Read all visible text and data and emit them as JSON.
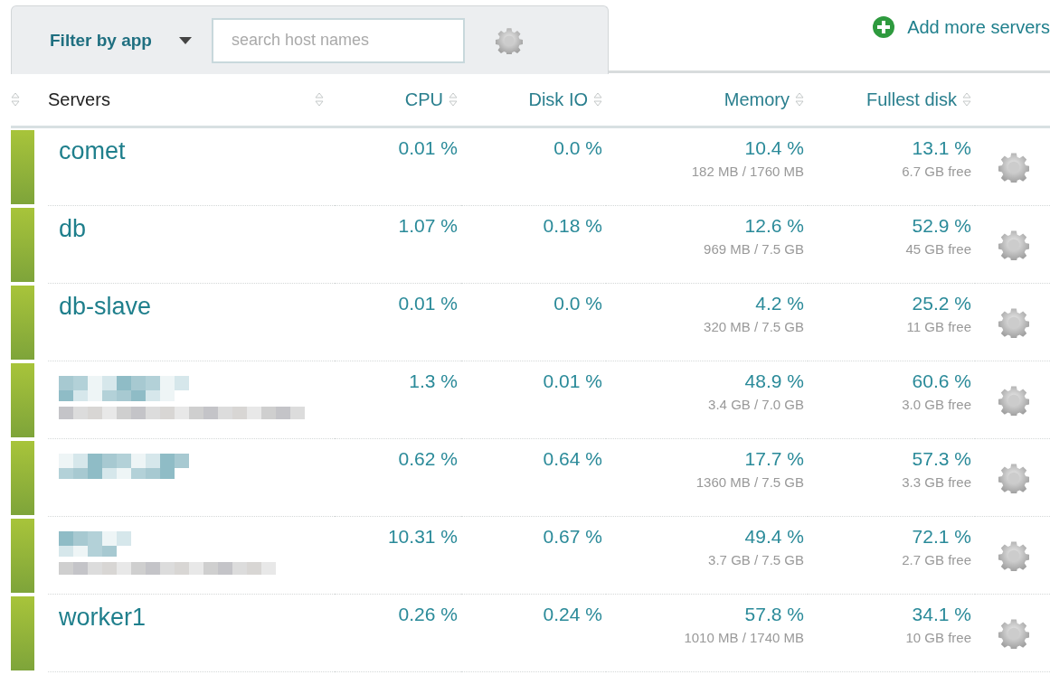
{
  "toolbar": {
    "filter": {
      "label": "Filter by app"
    },
    "search": {
      "placeholder": "search host names"
    }
  },
  "add_link": "Add more servers",
  "table": {
    "columns": [
      "Servers",
      "CPU",
      "Disk IO",
      "Memory",
      "Fullest disk"
    ],
    "rows": [
      {
        "kind": "named",
        "name": "comet",
        "cpu": "0.01 %",
        "disk_io": "0.0 %",
        "memory": "10.4 %",
        "memory_detail": "182 MB / 1760 MB",
        "disk": "13.1 %",
        "disk_detail": "6.7 GB free"
      },
      {
        "kind": "named",
        "name": "db",
        "cpu": "1.07 %",
        "disk_io": "0.18 %",
        "memory": "12.6 %",
        "memory_detail": "969 MB / 7.5 GB",
        "disk": "52.9 %",
        "disk_detail": "45 GB free"
      },
      {
        "kind": "named",
        "name": "db-slave",
        "cpu": "0.01 %",
        "disk_io": "0.0 %",
        "memory": "4.2 %",
        "memory_detail": "320 MB / 7.5 GB",
        "disk": "25.2 %",
        "disk_detail": "11 GB free"
      },
      {
        "kind": "redacted",
        "cpu": "1.3 %",
        "disk_io": "0.01 %",
        "memory": "48.9 %",
        "memory_detail": "3.4 GB / 7.0 GB",
        "disk": "60.6 %",
        "disk_detail": "3.0 GB free"
      },
      {
        "kind": "redacted",
        "cpu": "0.62 %",
        "disk_io": "0.64 %",
        "memory": "17.7 %",
        "memory_detail": "1360 MB / 7.5 GB",
        "disk": "57.3 %",
        "disk_detail": "3.3 GB free"
      },
      {
        "kind": "redacted",
        "cpu": "10.31 %",
        "disk_io": "0.67 %",
        "memory": "49.4 %",
        "memory_detail": "3.7 GB / 7.5 GB",
        "disk": "72.1 %",
        "disk_detail": "2.7 GB free"
      },
      {
        "kind": "named",
        "name": "worker1",
        "cpu": "0.26 %",
        "disk_io": "0.24 %",
        "memory": "57.8 %",
        "memory_detail": "1010 MB / 1740 MB",
        "disk": "34.1 %",
        "disk_detail": "10 GB free"
      }
    ]
  }
}
